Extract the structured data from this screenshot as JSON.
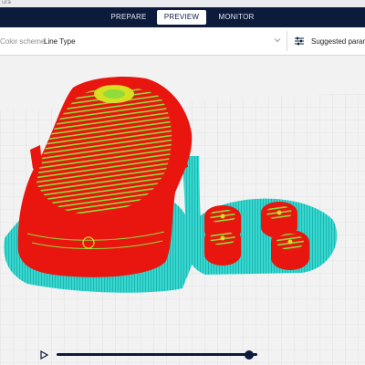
{
  "window": {
    "app_title": "ura"
  },
  "stages": [
    {
      "label": "PREPARE",
      "active": false
    },
    {
      "label": "PREVIEW",
      "active": true
    },
    {
      "label": "MONITOR",
      "active": false
    }
  ],
  "toolbar": {
    "color_scheme_label": "Color scheme",
    "color_scheme_value": "Line Type",
    "settings_label": "Suggested parame"
  },
  "playback": {
    "progress": 0.96
  },
  "colors": {
    "stage_bar": "#0c1a3c",
    "wall_outer": "#e8160f",
    "infill": "#8fdc3a",
    "top_skin": "#d6e020",
    "support_brim": "#37d7d0",
    "build_plate": "#f2f2f2"
  },
  "icons": [
    "play-icon",
    "chevron-down-icon",
    "settings-sliders-icon"
  ]
}
